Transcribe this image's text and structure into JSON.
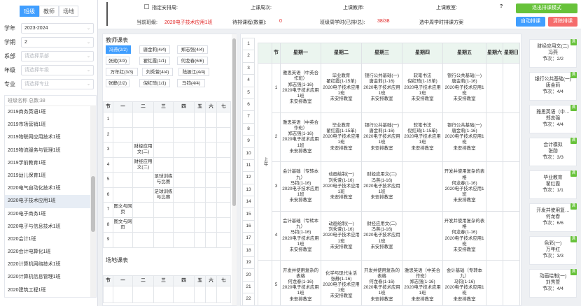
{
  "left": {
    "tabs": [
      "班级",
      "教师",
      "场地"
    ],
    "active_tab": 0,
    "filters": [
      {
        "label": "学年",
        "value": "2023-2024",
        "ph": false
      },
      {
        "label": "学期",
        "value": "2",
        "ph": false
      },
      {
        "label": "系部",
        "value": "请选择系部",
        "ph": true
      },
      {
        "label": "年级",
        "value": "请选择年级",
        "ph": true
      },
      {
        "label": "专业",
        "value": "请选择专业",
        "ph": true
      }
    ],
    "list_header": "班级名称 总数:38",
    "classes": [
      "2019商务英语1班",
      "2019市场营销1班",
      "2019物联网应用技术1班",
      "2019物流服务与管理1班",
      "2019学前教育1班",
      "2019幼儿保育1班",
      "2020电气自动化技术1班",
      "2020电子技术应用1班",
      "2020电子商务1班",
      "2020电子与信息技术1班",
      "2020会计1班",
      "2020会计电算化1班",
      "2020计算机网络技术1班",
      "2020计算机信息管理1班",
      "2020建筑工程1班"
    ],
    "selected_class": "2020电子技术应用1班"
  },
  "top": {
    "arrange_label": "指定安排周:",
    "class_week_label": "上课周次:",
    "teacher_label": "上课教师:",
    "room_label": "上课教室:",
    "current_class_label": "当前班级:",
    "current_class": "2020电子技术应用1班",
    "pending_label": "待排课程(数量):",
    "pending_count": "0",
    "week_hours_label": "班级周学时(已排/总):",
    "week_hours": "38/38",
    "choose_plan": "选中周学时排课方案",
    "exit_btn": "退出排课模式",
    "auto_btn": "自动排课",
    "clear_btn": "清除排课"
  },
  "teacher_panel": {
    "title": "教师课表",
    "teachers": [
      "冯燕(2/2)",
      "唐金莉(4/4)",
      "郑志强(4/4)",
      "张勋(3/3)",
      "翟红霞(1/1)",
      "何龙春(6/6)",
      "万年红(3/3)",
      "刘秀萱(4/4)",
      "陆振江(4/4)",
      "张静(2/2)",
      "倪红琦(1/1)",
      "马钧(4/4)"
    ],
    "active": 0,
    "headers": [
      "节",
      "一",
      "二",
      "三",
      "四",
      "五",
      "六",
      "七"
    ],
    "periods": [
      "1",
      "2",
      "3",
      "4",
      "5",
      "6",
      "7",
      "8",
      "9"
    ],
    "cells": [
      {
        "p": 2,
        "d": 2,
        "t": "财经应用文(二)"
      },
      {
        "p": 3,
        "d": 2,
        "t": "财经应用文(二)"
      },
      {
        "p": 4,
        "d": 3,
        "t": "足球训练与比赛"
      },
      {
        "p": 5,
        "d": 3,
        "t": "足球训练与比赛"
      },
      {
        "p": 6,
        "d": 1,
        "t": "图文与网页"
      },
      {
        "p": 7,
        "d": 1,
        "t": "图文与网页"
      }
    ]
  },
  "room_panel": {
    "title": "场地课表"
  },
  "schedule": {
    "headers": [
      "节",
      "星期一",
      "星期二",
      "星期三",
      "星期四",
      "星期五",
      "星期六",
      "星期日"
    ],
    "side_nums": [
      "1",
      "2",
      "3",
      "4",
      "5",
      "6",
      "7",
      "8",
      "9",
      "10",
      "11",
      "12",
      "13",
      "14",
      "15",
      "16",
      "17",
      "18",
      "19",
      "20",
      "21",
      "22"
    ],
    "half_label": "上午",
    "rows": [
      {
        "period": "1",
        "cells": [
          "雅思英语（中英合作班）\n郑志强(1-16)\n2020电子技术应用1班\n未安排教室",
          "毕业教育\n翟红霞(1-15单)\n2020电子技术应用1班\n未安排教室",
          "银行公共基础(一)\n唐金莉(1-16)\n2020电子技术应用1班\n未安排教室",
          "软笔书法\n倪红琦(1-15单)\n2020电子技术应用1班\n未安排教室",
          "银行公共基础(一)\n唐金莉(1-16)\n2020电子技术应用1班\n未安排教室",
          "",
          ""
        ]
      },
      {
        "period": "2",
        "cells": [
          "雅思英语（中英合作班）\n郑志强(1-16)\n2020电子技术应用1班\n未安排教室",
          "毕业教育\n翟红霞(1-15单)\n2020电子技术应用1班\n未安排教室",
          "银行公共基础(一)\n唐金莉(1-16)\n2020电子技术应用1班\n未安排教室",
          "软笔书法\n倪红琦(1-15单)\n2020电子技术应用1班\n未安排教室",
          "银行公共基础(一)\n唐金莉(1-16)\n2020电子技术应用1班\n未安排教室",
          "",
          ""
        ]
      },
      {
        "period": "3",
        "cells": [
          "会计基础（专转本九）\n马钧(1-16)\n2020电子技术应用1班\n未安排教室",
          "动画绘制(一)\n刘秀萱(1-16)\n2020电子技术应用1班\n未安排教室",
          "财经应用文(二)\n冯燕(1-16)\n2020电子技术应用1班\n未安排教室",
          "",
          "开发并使用复杂的表格\n何龙春(1-16)\n2020电子技术应用1班\n未安排教室",
          "",
          ""
        ]
      },
      {
        "period": "4",
        "cells": [
          "会计基础（专转本九）\n马钧(1-16)\n2020电子技术应用1班\n未安排教室",
          "动画绘制(一)\n刘秀萱(1-16)\n2020电子技术应用1班\n未安排教室",
          "财经应用文(二)\n冯燕(1-16)\n2020电子技术应用1班\n未安排教室",
          "",
          "开发并使用复杂的表格\n何龙春(1-16)\n2020电子技术应用1班\n未安排教室",
          "",
          ""
        ]
      },
      {
        "period": "5",
        "cells": [
          "开发并使用复杂的表格\n何龙春(1-16)\n2020电子技术应用1班\n未安排教室",
          "化学与现代生活\n张静(1-16)\n2020电子技术应用1班\n未安排教室",
          "开发并使用复杂的表格\n何龙春(1-16)\n2020电子技术应用1班\n未安排教室",
          "雅思英语（中英合作班）\n郑志强(1-16)\n2020电子技术应用1班\n未安排教室",
          "会计基础（专转本九）\n马钧(1-16)\n2020电子技术应用1班\n未安排教室",
          "",
          ""
        ]
      }
    ]
  },
  "pending": {
    "badge": "满",
    "cards": [
      {
        "name": "财经应用文(二)",
        "teacher": "冯燕",
        "hours": "节次：2/2"
      },
      {
        "name": "银行公共基础(一)",
        "teacher": "唐金莉",
        "hours": "节次：4/4"
      },
      {
        "name": "雅思英语（中…",
        "teacher": "郑志强",
        "hours": "节次：4/4"
      },
      {
        "name": "会计模拟",
        "teacher": "张勋",
        "hours": "节次：3/3"
      },
      {
        "name": "毕业教育",
        "teacher": "翟红霞",
        "hours": "节次：1/1"
      },
      {
        "name": "开发并使用复…",
        "teacher": "何龙春",
        "hours": "节次：6/6"
      },
      {
        "name": "色彩(一)",
        "teacher": "万年红",
        "hours": "节次：3/3"
      },
      {
        "name": "动画绘制(一)",
        "teacher": "刘秀萱",
        "hours": "节次：4/4"
      }
    ]
  }
}
